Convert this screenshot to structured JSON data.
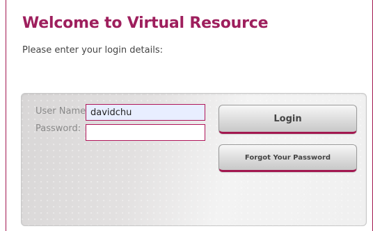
{
  "page": {
    "title": "Welcome to Virtual Resource",
    "subtitle": "Please enter your login details:"
  },
  "login_form": {
    "username_label": "User Name:",
    "username_value": "davidchu",
    "password_label": "Password:",
    "password_value": "",
    "login_button": "Login",
    "forgot_password_button": "Forgot Your Password"
  },
  "colors": {
    "brand": "#9e1f5d",
    "input_border": "#b0165a",
    "autofill_background": "#e8eeff"
  }
}
